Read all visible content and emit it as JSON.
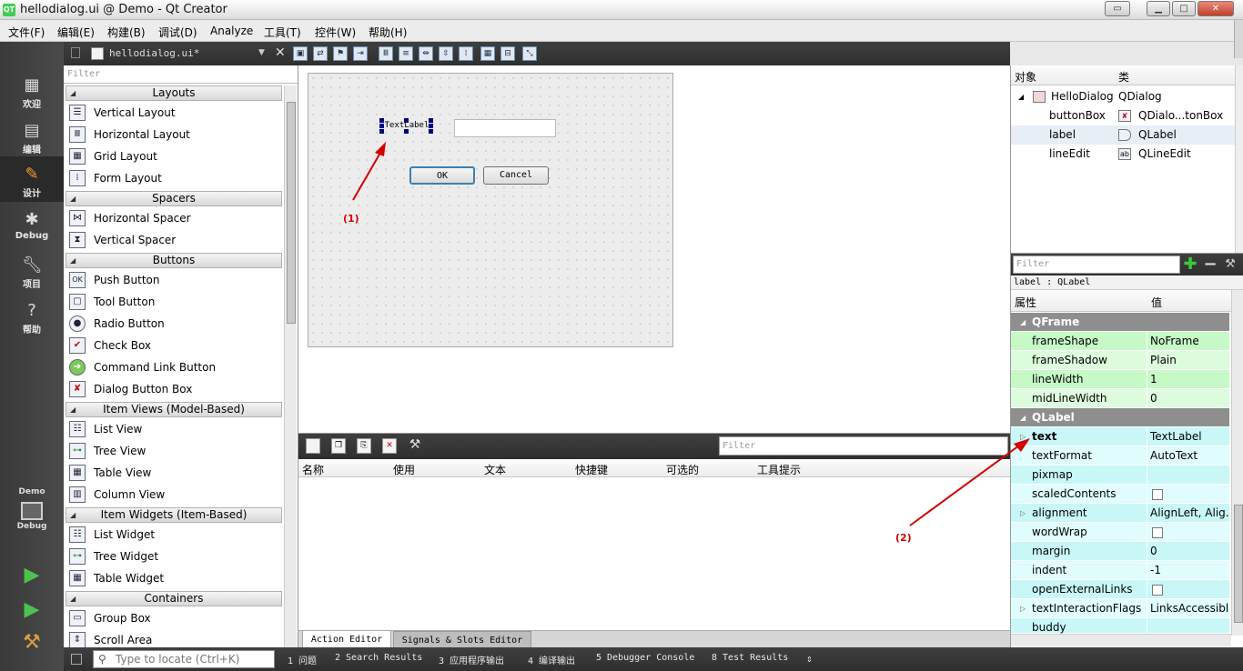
{
  "window": {
    "title": "hellodialog.ui @ Demo - Qt Creator",
    "logo": "QT"
  },
  "menu": [
    "文件(F)",
    "编辑(E)",
    "构建(B)",
    "调试(D)",
    "Analyze",
    "工具(T)",
    "控件(W)",
    "帮助(H)"
  ],
  "modes": [
    {
      "label": "欢迎",
      "icon": "grid-icon"
    },
    {
      "label": "编辑",
      "icon": "edit-document-icon"
    },
    {
      "label": "设计",
      "icon": "pencil-icon"
    },
    {
      "label": "Debug",
      "icon": "bug-icon"
    },
    {
      "label": "项目",
      "icon": "wrench-icon"
    },
    {
      "label": "帮助",
      "icon": "help-icon"
    }
  ],
  "kit": {
    "project": "Demo",
    "config": "Debug"
  },
  "document": {
    "file": "hellodialog.ui*"
  },
  "widget_box": {
    "filter_placeholder": "Filter",
    "categories": [
      {
        "title": "Layouts",
        "items": [
          "Vertical Layout",
          "Horizontal Layout",
          "Grid Layout",
          "Form Layout"
        ]
      },
      {
        "title": "Spacers",
        "items": [
          "Horizontal Spacer",
          "Vertical Spacer"
        ]
      },
      {
        "title": "Buttons",
        "items": [
          "Push Button",
          "Tool Button",
          "Radio Button",
          "Check Box",
          "Command Link Button",
          "Dialog Button Box"
        ]
      },
      {
        "title": "Item Views (Model-Based)",
        "items": [
          "List View",
          "Tree View",
          "Table View",
          "Column View"
        ]
      },
      {
        "title": "Item Widgets (Item-Based)",
        "items": [
          "List Widget",
          "Tree Widget",
          "Table Widget"
        ]
      },
      {
        "title": "Containers",
        "items": [
          "Group Box",
          "Scroll Area"
        ]
      }
    ]
  },
  "form": {
    "label_text": "TextLabel",
    "ok": "OK",
    "cancel": "Cancel",
    "annotation_1": "(1)",
    "annotation_2": "(2)"
  },
  "action_editor": {
    "filter_placeholder": "Filter",
    "columns": [
      "名称",
      "使用",
      "文本",
      "快捷键",
      "可选的",
      "工具提示"
    ],
    "tabs": [
      "Action Editor",
      "Signals & Slots Editor"
    ]
  },
  "object_inspector": {
    "columns": [
      "对象",
      "类"
    ],
    "rows": [
      {
        "name": "HelloDialog",
        "class": "QDialog"
      },
      {
        "name": "buttonBox",
        "class": "QDialo...tonBox"
      },
      {
        "name": "label",
        "class": "QLabel"
      },
      {
        "name": "lineEdit",
        "class": "QLineEdit"
      }
    ]
  },
  "property_editor": {
    "filter_placeholder": "Filter",
    "object_label": "label : QLabel",
    "columns": [
      "属性",
      "值"
    ],
    "groups": [
      {
        "name": "QFrame",
        "rows": [
          {
            "name": "frameShape",
            "value": "NoFrame"
          },
          {
            "name": "frameShadow",
            "value": "Plain"
          },
          {
            "name": "lineWidth",
            "value": "1"
          },
          {
            "name": "midLineWidth",
            "value": "0"
          }
        ]
      },
      {
        "name": "QLabel",
        "rows": [
          {
            "name": "text",
            "value": "TextLabel"
          },
          {
            "name": "textFormat",
            "value": "AutoText"
          },
          {
            "name": "pixmap",
            "value": ""
          },
          {
            "name": "scaledContents",
            "value": ""
          },
          {
            "name": "alignment",
            "value": "AlignLeft, Alig..."
          },
          {
            "name": "wordWrap",
            "value": ""
          },
          {
            "name": "margin",
            "value": "0"
          },
          {
            "name": "indent",
            "value": "-1"
          },
          {
            "name": "openExternalLinks",
            "value": ""
          },
          {
            "name": "textInteractionFlags",
            "value": "LinksAccessibl..."
          },
          {
            "name": "buddy",
            "value": ""
          }
        ]
      }
    ]
  },
  "statusbar": {
    "locator_placeholder": "Type to locate (Ctrl+K)",
    "panes": [
      "1  问题",
      "2  Search Results",
      "3  应用程序输出",
      "4  编译输出",
      "5  Debugger Console",
      "8  Test Results"
    ]
  },
  "colors": {
    "selection_handle": "#000080",
    "annotation": "#d40000",
    "frame_group": "#c7f9c7",
    "label_group": "#c9f7f7"
  }
}
